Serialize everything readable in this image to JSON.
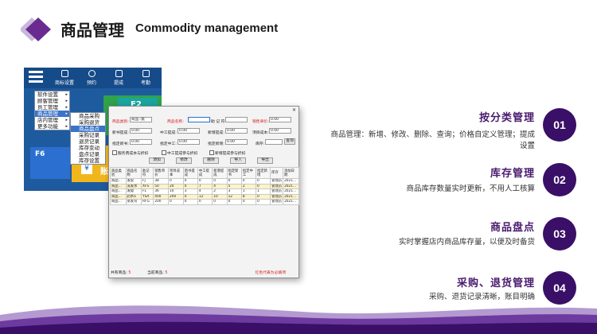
{
  "header": {
    "title_cn": "商品管理",
    "title_en": "Commodity management",
    "accent_color": "#4a1b6d"
  },
  "app": {
    "toolbar": [
      {
        "label": "商标设置",
        "icon": "gear-icon"
      },
      {
        "label": "预约",
        "icon": "clock-icon"
      },
      {
        "label": "提成",
        "icon": "coins-icon"
      },
      {
        "label": "考勤",
        "icon": "calendar-icon"
      }
    ],
    "tiles": {
      "f2": "F2",
      "f6": "F6",
      "yellow_text": "账目",
      "yen": "¥"
    },
    "menu": [
      {
        "label": "软件设置",
        "selected": false
      },
      {
        "label": "顾客管理",
        "selected": false
      },
      {
        "label": "员工管理",
        "selected": false
      },
      {
        "label": "商品管理",
        "selected": true
      },
      {
        "label": "店内管理",
        "selected": false
      },
      {
        "label": "更多功能",
        "selected": false
      }
    ],
    "submenu": [
      {
        "label": "商品采购",
        "selected": false
      },
      {
        "label": "采购退货",
        "selected": false
      },
      {
        "label": "商品盘点",
        "selected": true
      },
      {
        "label": "采购记录",
        "selected": false
      },
      {
        "label": "退货记录",
        "selected": false
      },
      {
        "label": "库存变动",
        "selected": false
      },
      {
        "label": "盘点记录",
        "selected": false
      },
      {
        "label": "库存设置",
        "selected": false
      }
    ]
  },
  "dialog": {
    "fields": {
      "category_label": "商品类别:",
      "category_value": "商品--类",
      "name_label": "商品名称:",
      "remember_label": "助 记 符:",
      "price_label": "销售单价:",
      "price_value": "0.00",
      "purchase_label": "新书提成:",
      "purchase_value": "0.00",
      "mid_label": "中工提成:",
      "mid_value": "0.00",
      "newcard_label": "新增提成:",
      "newcard_value": "0.00",
      "cost_label": "项目成本:",
      "cost_value": "0.00",
      "fixed_new_label": "指定新书:",
      "fixed_new_value": "0.00",
      "fixed_mid_label": "指定中工:",
      "fixed_mid_value": "0.00",
      "fixed_add_label": "指定新增:",
      "fixed_add_value": "0.00",
      "stock_label": "库存:",
      "query_button": "查询"
    },
    "checkboxes": [
      "服务费成本与折扣",
      "中工提成参与折扣",
      "新增提成参与折扣"
    ],
    "buttons": [
      "添加",
      "修改",
      "删除",
      "导入",
      "导出"
    ],
    "table": {
      "headers": [
        "商品类别",
        "商品名称",
        "助记符",
        "销售单价",
        "项目成本",
        "新书提成",
        "中工提成",
        "新增提成",
        "指定新书",
        "指定中工",
        "指定新增",
        "库存",
        "添加日期"
      ],
      "rows": [
        {
          "cells": [
            "商品…",
            "发胶",
            "FJ",
            "38",
            "0",
            "0",
            "0",
            "0",
            "0",
            "0",
            "0",
            "管理员",
            "2021…"
          ],
          "hl": false
        },
        {
          "cells": [
            "商品…",
            "洗发水",
            "XFS",
            "50",
            "20",
            "0",
            "7",
            "4",
            "5",
            "2",
            "0",
            "管理员",
            "2021…"
          ],
          "hl": true
        },
        {
          "cells": [
            "商品…",
            "发蜡",
            "FL",
            "36",
            "10",
            "3",
            "4",
            "2",
            "3",
            "1",
            "1",
            "管理员",
            "2021…"
          ],
          "hl": false
        },
        {
          "cells": [
            "商品…",
            "药水a",
            "YSA",
            "400",
            "200",
            "0",
            "12",
            "10",
            "12",
            "8",
            "0",
            "管理员",
            "2021…"
          ],
          "hl": true
        },
        {
          "cells": [
            "商品…",
            "染发膏",
            "RFG",
            "200",
            "0",
            "0",
            "0",
            "0",
            "0",
            "0",
            "0",
            "管理员",
            "2021…"
          ],
          "hl": false
        }
      ]
    },
    "footer": {
      "total_label": "共有商品:",
      "total_value": "5",
      "current_label": "当前商品:",
      "current_value": "5",
      "note": "红色代表为必填项"
    }
  },
  "features": [
    {
      "num": "01",
      "title": "按分类管理",
      "desc": "商品管理：新增、修改、删除、查询；价格自定义管理；提成设置"
    },
    {
      "num": "02",
      "title": "库存管理",
      "desc": "商品库存数量实时更新，不用人工核算"
    },
    {
      "num": "03",
      "title": "商品盘点",
      "desc": "实时掌握店内商品库存量，以便及时备货"
    },
    {
      "num": "04",
      "title": "采购、退货管理",
      "desc": "采购、退货记录清晰，账目明确"
    }
  ]
}
